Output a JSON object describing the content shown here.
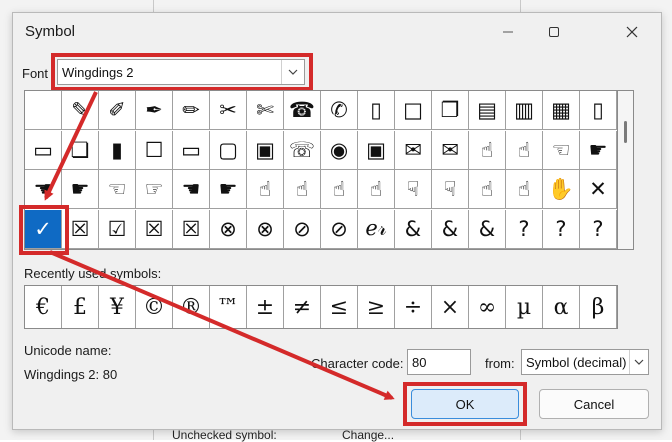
{
  "dialog": {
    "title": "Symbol",
    "minimize_icon": "minimize-icon",
    "maximize_icon": "maximize-icon",
    "close_icon": "close-icon"
  },
  "font": {
    "label": "Font",
    "value": "Wingdings 2"
  },
  "symbol_grid": [
    [
      "",
      "✎",
      "✐",
      "✒",
      "✏",
      "✂",
      "✄",
      "☎",
      "✆",
      "▯",
      "□",
      "❐",
      "▤",
      "▥",
      "▦",
      "▯"
    ],
    [
      "▭",
      "❏",
      "▮",
      "☐",
      "▭",
      "▢",
      "▣",
      "☏",
      "◉",
      "▣",
      "✉",
      "✉",
      "☝",
      "☝",
      "☜",
      "☛"
    ],
    [
      "☚",
      "☛",
      "☜",
      "☞",
      "☚",
      "☛",
      "☝",
      "☝",
      "☝",
      "☝",
      "☟",
      "☟",
      "☝",
      "☝",
      "✋",
      "✕"
    ],
    [
      "✓",
      "☒",
      "☑",
      "☒",
      "☒",
      "⊗",
      "⊗",
      "⊘",
      "⊘",
      "ℯ𝓇",
      "&",
      "&",
      "&",
      "?",
      "?",
      "?"
    ]
  ],
  "selected_symbol": "✓",
  "recent": {
    "label": "Recently used symbols:",
    "symbols": [
      "€",
      "£",
      "¥",
      "©",
      "®",
      "™",
      "±",
      "≠",
      "≤",
      "≥",
      "÷",
      "×",
      "∞",
      "µ",
      "α",
      "β"
    ]
  },
  "unicode_name": {
    "label": "Unicode name:",
    "value": "Wingdings 2: 80"
  },
  "character_code": {
    "label": "Character code:",
    "value": "80"
  },
  "from": {
    "label": "from:",
    "value": "Symbol (decimal)"
  },
  "buttons": {
    "ok": "OK",
    "cancel": "Cancel"
  },
  "behind_window": {
    "unchecked_label": "Unchecked symbol:",
    "change_label": "Change..."
  },
  "colors": {
    "annotation_red": "#d42a2a",
    "selection_blue": "#0f6ac4"
  }
}
